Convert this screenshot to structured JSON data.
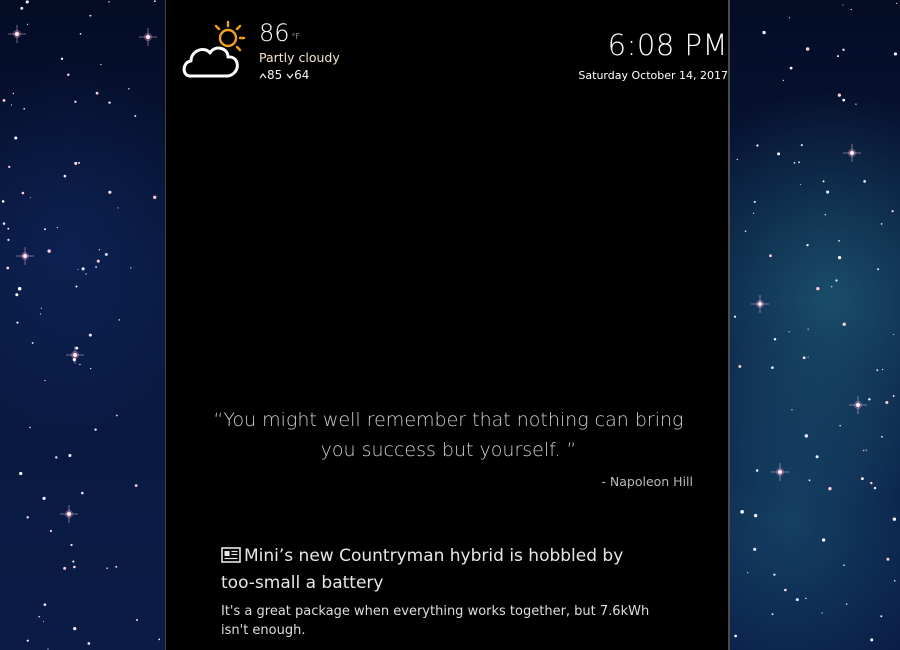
{
  "weather": {
    "icon": "partly-cloudy-icon",
    "temperature": "86",
    "unit": "°F",
    "condition": "Partly cloudy",
    "high": "85",
    "low": "64",
    "sun_color": "#f0a020"
  },
  "clock": {
    "time": "6:08 PM",
    "date": "Saturday October 14, 2017"
  },
  "quote": {
    "text": "“You might well remember that nothing can bring you success but yourself. ”",
    "author": "- Napoleon Hill"
  },
  "news": {
    "icon": "newspaper-icon",
    "headline": "Mini’s new Countryman hybrid is hobbled by too-small a battery",
    "summary": "It's a great package when everything works together, but 7.6kWh isn't enough."
  },
  "colors": {
    "mirror_background": "#000000",
    "wallpaper": "#061433"
  }
}
